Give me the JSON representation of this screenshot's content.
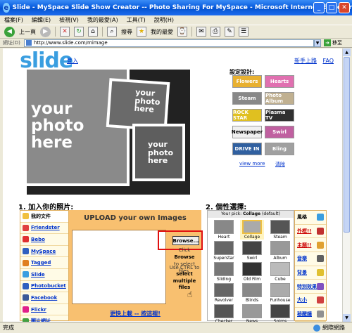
{
  "window": {
    "title": "Slide - MySpace Slide Show Creator -- Photo Sharing For MySpace - Microsoft Internet Explorer"
  },
  "menu": [
    "檔案(F)",
    "編輯(E)",
    "檢視(V)",
    "我的最愛(A)",
    "工具(T)",
    "說明(H)"
  ],
  "toolbar": {
    "back_label": "上一頁",
    "search_label": "搜尋",
    "favorites_label": "我的最愛"
  },
  "address": {
    "label": "網址(D)",
    "url": "http://www.slide.com/mimage",
    "go_label": "移至"
  },
  "status": {
    "text": "完成",
    "zone": "網際網路"
  },
  "page": {
    "logo": "slide",
    "login": "登入",
    "top_links": [
      "新手上路",
      "FAQ"
    ],
    "collage_caption": "your photo here",
    "design_title": "設定設計:",
    "design_tiles": [
      {
        "label": "Flowers",
        "color": "#e8b030"
      },
      {
        "label": "Hearts",
        "color": "#e070b0"
      },
      {
        "label": "Steam",
        "color": "#888888"
      },
      {
        "label": "Photo Album",
        "color": "#c0b090"
      },
      {
        "label": "ROCK STAR",
        "color": "#e0c020"
      },
      {
        "label": "Plasma TV",
        "color": "#303030"
      },
      {
        "label": "Newspaper",
        "color": "#f0f0f0"
      },
      {
        "label": "Swirl",
        "color": "#c060a0"
      },
      {
        "label": "DRIVE IN",
        "color": "#3060a0"
      },
      {
        "label": "Bling",
        "color": "#a0a0a0"
      }
    ],
    "view_more": "view more",
    "clear": "清除",
    "step1": "1. 加入你的照片:",
    "step2": "2. 個性選擇:",
    "sources": [
      {
        "label": "我的文件",
        "color": "#f0c040",
        "active": true
      },
      {
        "label": "Friendster",
        "color": "#e04040"
      },
      {
        "label": "Bebo",
        "color": "#e03030"
      },
      {
        "label": "MySpace",
        "color": "#3060c0"
      },
      {
        "label": "Tagged",
        "color": "#e08020"
      },
      {
        "label": "Slide",
        "color": "#3a9ee0"
      },
      {
        "label": "Photobucket",
        "color": "#3060c0"
      },
      {
        "label": "Facebook",
        "color": "#3b5998"
      },
      {
        "label": "Flickr",
        "color": "#e0208a"
      },
      {
        "label": "圖片網址",
        "color": "#40a040"
      }
    ],
    "upload": {
      "title": "UPLOAD your own Images",
      "browse": "Browse...",
      "hint1_a": "Click",
      "hint1_b": "Browse",
      "hint1_c": "to select files.",
      "hint2_a": "Use CTRL to",
      "hint2_b": "select multiple files",
      "fast_upload": "更快上載 -- 按這裡!"
    },
    "style_pick_prefix": "Your pick:",
    "style_pick_value": "Collage",
    "style_pick_suffix": "(default)",
    "styles": [
      {
        "label": "Heart",
        "color": "#888"
      },
      {
        "label": "Collage",
        "color": "#aaa",
        "selected": true
      },
      {
        "label": "Steam",
        "color": "#555"
      },
      {
        "label": "Superstar",
        "color": "#666"
      },
      {
        "label": "Swirl",
        "color": "#444"
      },
      {
        "label": "Album",
        "color": "#999"
      },
      {
        "label": "Sliding",
        "color": "#777"
      },
      {
        "label": "Old Film",
        "color": "#333"
      },
      {
        "label": "Cube",
        "color": "#bbb"
      },
      {
        "label": "Revolver",
        "color": "#666"
      },
      {
        "label": "Blinds",
        "color": "#888"
      },
      {
        "label": "Funhouse",
        "color": "#aaa"
      },
      {
        "label": "Checker",
        "color": "#555"
      },
      {
        "label": "News",
        "color": "#999"
      },
      {
        "label": "Spiros",
        "color": "#444"
      }
    ],
    "categories": [
      {
        "label": "風格",
        "color": "#3a9ee0",
        "active": true
      },
      {
        "label": "外框!!",
        "color": "#c03030",
        "red": true
      },
      {
        "label": "主題!!",
        "color": "#e0a030",
        "red": true
      },
      {
        "label": "音樂",
        "color": "#606060"
      },
      {
        "label": "背景",
        "color": "#e0c030"
      },
      {
        "label": "特別效果",
        "color": "#8050c0"
      },
      {
        "label": "大小",
        "color": "#d04040"
      },
      {
        "label": "秘醒鐘",
        "color": "#909090"
      }
    ]
  }
}
